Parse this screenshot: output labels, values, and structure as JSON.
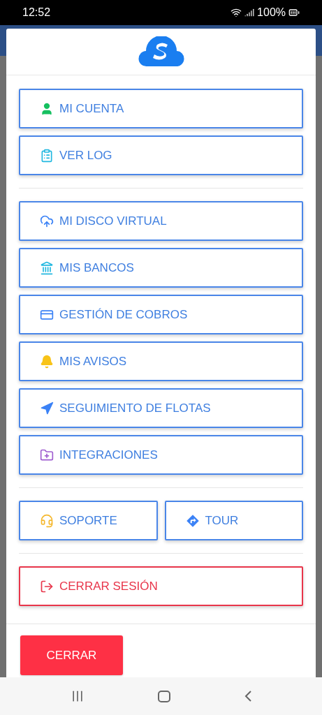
{
  "status_bar": {
    "time": "12:52",
    "battery": "100%"
  },
  "menu_groups": [
    {
      "kind": "stack",
      "items": [
        {
          "label": "MI CUENTA",
          "kind": "user"
        },
        {
          "label": "VER LOG",
          "kind": "clipboard"
        }
      ]
    },
    {
      "kind": "stack",
      "items": [
        {
          "label": "MI DISCO VIRTUAL",
          "kind": "cloud"
        },
        {
          "label": "MIS BANCOS",
          "kind": "bank"
        },
        {
          "label": "GESTIÓN DE COBROS",
          "kind": "card"
        },
        {
          "label": "MIS AVISOS",
          "kind": "bell"
        },
        {
          "label": "SEGUIMIENTO DE FLOTAS",
          "kind": "navigation"
        },
        {
          "label": "INTEGRACIONES",
          "kind": "folder"
        }
      ]
    },
    {
      "kind": "row",
      "items": [
        {
          "label": "SOPORTE",
          "kind": "headset"
        },
        {
          "label": "TOUR",
          "kind": "direction"
        }
      ]
    },
    {
      "kind": "stack",
      "items": [
        {
          "label": "CERRAR SESIÓN",
          "kind": "logout"
        }
      ]
    }
  ],
  "close_button": "CERRAR"
}
